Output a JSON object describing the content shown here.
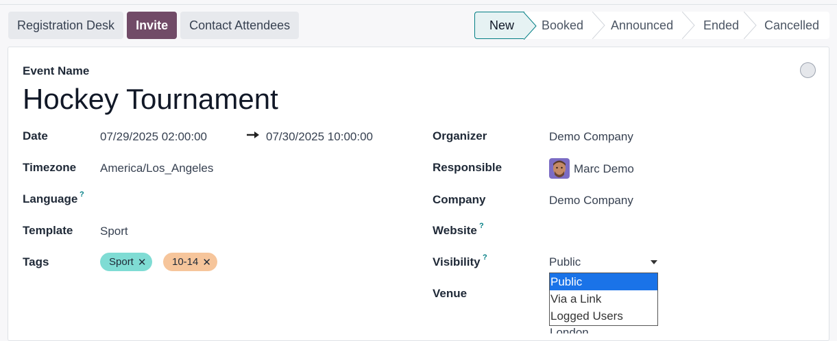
{
  "actions": {
    "registration_desk": "Registration Desk",
    "invite": "Invite",
    "contact_attendees": "Contact Attendees"
  },
  "statusbar": {
    "stages": [
      "New",
      "Booked",
      "Announced",
      "Ended",
      "Cancelled"
    ],
    "active": "New"
  },
  "form": {
    "event_name_label": "Event Name",
    "event_name": "Hockey Tournament",
    "left": {
      "date_label": "Date",
      "date_begin": "07/29/2025 02:00:00",
      "date_end": "07/30/2025 10:00:00",
      "timezone_label": "Timezone",
      "timezone": "America/Los_Angeles",
      "language_label": "Language",
      "template_label": "Template",
      "template": "Sport",
      "tags_label": "Tags",
      "tags": [
        {
          "label": "Sport",
          "color": "#7fdcd4"
        },
        {
          "label": "10-14",
          "color": "#f6c59b"
        }
      ]
    },
    "right": {
      "organizer_label": "Organizer",
      "organizer": "Demo Company",
      "responsible_label": "Responsible",
      "responsible": "Marc Demo",
      "company_label": "Company",
      "company": "Demo Company",
      "website_label": "Website",
      "visibility_label": "Visibility",
      "visibility": "Public",
      "visibility_options": [
        "Public",
        "Via a Link",
        "Logged Users"
      ],
      "venue_label": "Venue",
      "venue_partial": "London"
    },
    "help_marker": "?"
  },
  "colors": {
    "brand": "#714b67",
    "accent": "#017e84",
    "dropdown_selected": "#1a73e8"
  }
}
